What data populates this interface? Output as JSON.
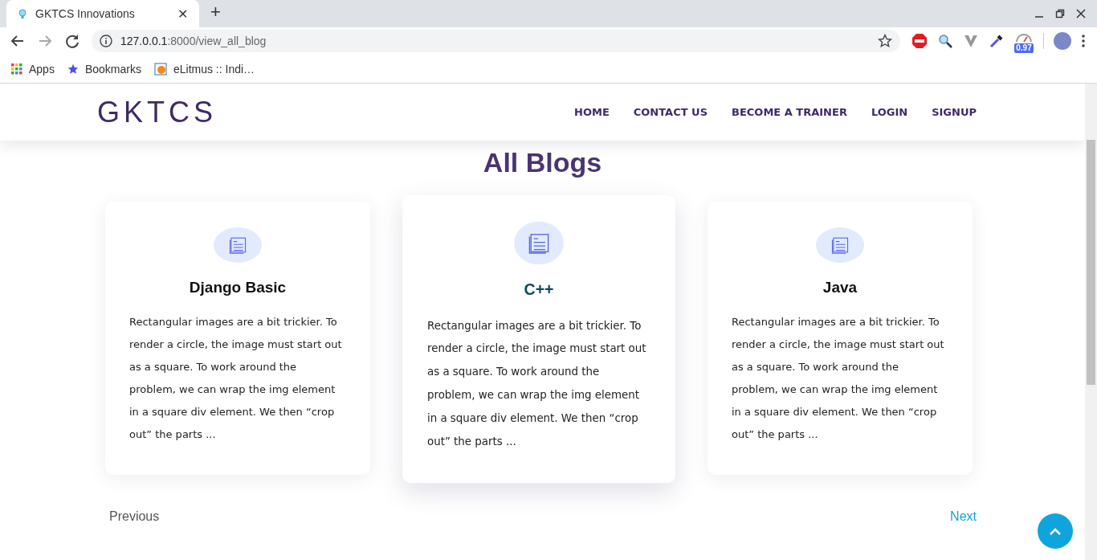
{
  "browser": {
    "tab_title": "GKTCS Innovations",
    "url": {
      "host": "127.0.0.1",
      "rest": ":8000/view_all_blog"
    },
    "bookmarks": [
      {
        "kind": "apps",
        "label": "Apps"
      },
      {
        "kind": "star",
        "label": "Bookmarks"
      },
      {
        "kind": "site",
        "label": "eLitmus :: Indi…"
      }
    ],
    "extension_badge": "0.97",
    "close_tab": "✕",
    "new_tab": "+"
  },
  "site": {
    "logo": "GKTCS",
    "nav": [
      "HOME",
      "CONTACT US",
      "BECOME A TRAINER",
      "LOGIN",
      "SIGNUP"
    ]
  },
  "heading": "All Blogs",
  "cards": [
    {
      "title": "Django Basic",
      "excerpt": "Rectangular images are a bit trickier. To render a circle, the image must start out as a square. To work around the problem, we can wrap the img element in a square div element. We then “crop out” the parts ...",
      "hovered": false
    },
    {
      "title": "C++",
      "excerpt": "Rectangular images are a bit trickier. To render a circle, the image must start out as a square. To work around the problem, we can wrap the img element in a square div element. We then “crop out” the parts ...",
      "hovered": true
    },
    {
      "title": "Java",
      "excerpt": "Rectangular images are a bit trickier. To render a circle, the image must start out as a square. To work around the problem, we can wrap the img element in a square div element. We then “crop out” the parts ...",
      "hovered": false
    }
  ],
  "pager": {
    "previous": "Previous",
    "next": "Next"
  }
}
